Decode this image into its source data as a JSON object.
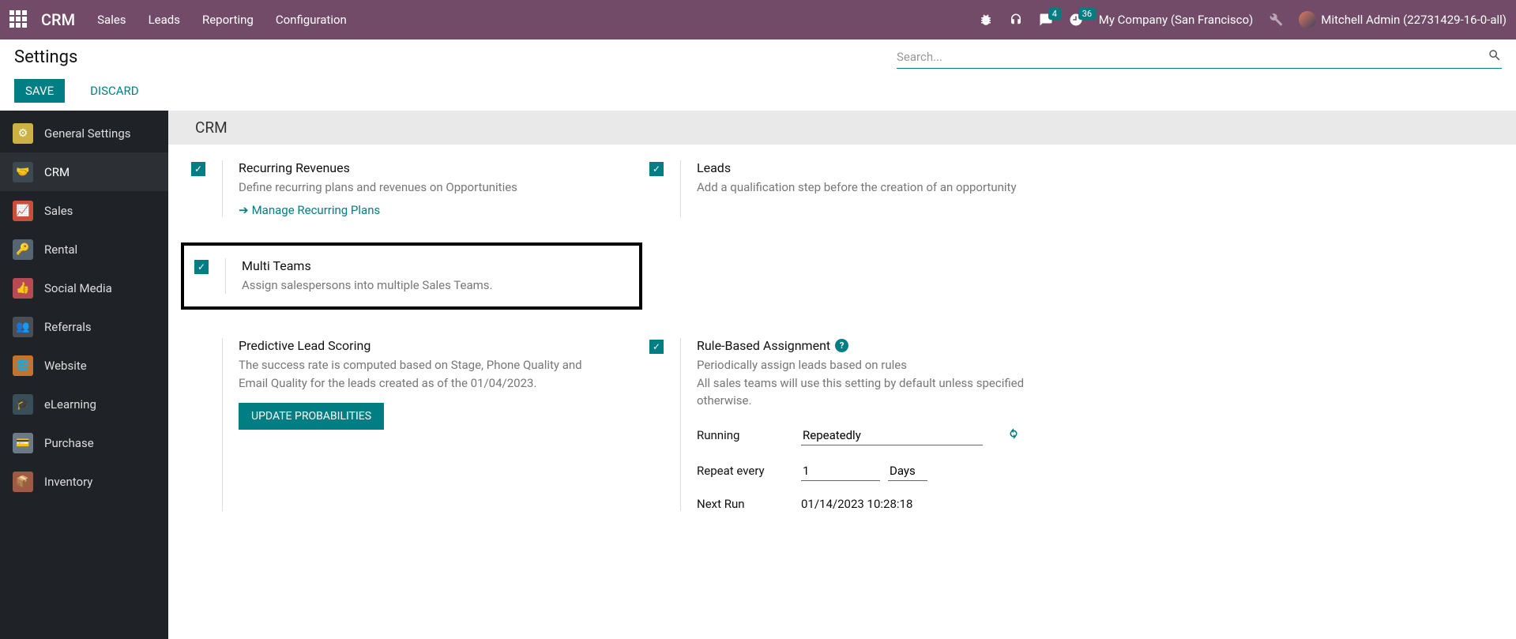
{
  "navbar": {
    "brand": "CRM",
    "items": [
      "Sales",
      "Leads",
      "Reporting",
      "Configuration"
    ],
    "messages_badge": "4",
    "activities_badge": "36",
    "company": "My Company (San Francisco)",
    "user": "Mitchell Admin (22731429-16-0-all)"
  },
  "controlbar": {
    "title": "Settings",
    "search_placeholder": "Search..."
  },
  "actions": {
    "save": "SAVE",
    "discard": "DISCARD"
  },
  "sidebar": [
    {
      "label": "General Settings",
      "icon": "ic-general",
      "glyph": "⚙"
    },
    {
      "label": "CRM",
      "icon": "ic-crm",
      "glyph": "🤝",
      "active": true
    },
    {
      "label": "Sales",
      "icon": "ic-sales",
      "glyph": "📈"
    },
    {
      "label": "Rental",
      "icon": "ic-rental",
      "glyph": "🔑"
    },
    {
      "label": "Social Media",
      "icon": "ic-social",
      "glyph": "👍"
    },
    {
      "label": "Referrals",
      "icon": "ic-referrals",
      "glyph": "👥"
    },
    {
      "label": "Website",
      "icon": "ic-website",
      "glyph": "🌐"
    },
    {
      "label": "eLearning",
      "icon": "ic-elearning",
      "glyph": "🎓"
    },
    {
      "label": "Purchase",
      "icon": "ic-purchase",
      "glyph": "💳"
    },
    {
      "label": "Inventory",
      "icon": "ic-inventory",
      "glyph": "📦"
    }
  ],
  "section": {
    "title": "CRM"
  },
  "settings": {
    "recurring": {
      "title": "Recurring Revenues",
      "desc": "Define recurring plans and revenues on Opportunities",
      "link": "Manage Recurring Plans"
    },
    "leads": {
      "title": "Leads",
      "desc": "Add a qualification step before the creation of an opportunity"
    },
    "multiteams": {
      "title": "Multi Teams",
      "desc": "Assign salespersons into multiple Sales Teams."
    },
    "predictive": {
      "title": "Predictive Lead Scoring",
      "desc": "The success rate is computed based on Stage, Phone Quality and Email Quality for the leads created as of the 01/04/2023.",
      "button": "UPDATE PROBABILITIES"
    },
    "rulebased": {
      "title": "Rule-Based Assignment",
      "desc": "Periodically assign leads based on rules",
      "desc2": "All sales teams will use this setting by default unless specified otherwise.",
      "running_label": "Running",
      "running_value": "Repeatedly",
      "repeat_label": "Repeat every",
      "repeat_value": "1",
      "repeat_unit": "Days",
      "nextrun_label": "Next Run",
      "nextrun_value": "01/14/2023 10:28:18"
    }
  }
}
